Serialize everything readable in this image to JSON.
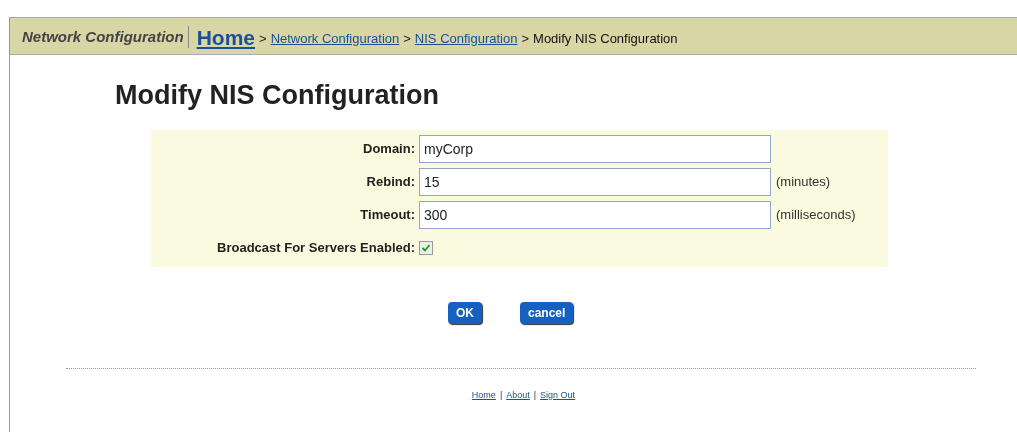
{
  "banner": {
    "section": "Network Configuration",
    "breadcrumb": [
      {
        "label": "Home",
        "kind": "home"
      },
      {
        "label": ">",
        "kind": "sep"
      },
      {
        "label": "Network Configuration",
        "kind": "link"
      },
      {
        "label": ">",
        "kind": "sep"
      },
      {
        "label": "NIS Configuration",
        "kind": "link"
      },
      {
        "label": ">",
        "kind": "sep"
      },
      {
        "label": "Modify NIS Configuration",
        "kind": "current"
      }
    ]
  },
  "title": "Modify NIS Configuration",
  "fields": [
    {
      "label": "Domain:",
      "kind": "text",
      "value": "myCorp"
    },
    {
      "label": "Rebind:",
      "kind": "text",
      "value": "15",
      "unit": "(minutes)"
    },
    {
      "label": "Timeout:",
      "kind": "text",
      "value": "300",
      "unit": "(milliseconds)"
    },
    {
      "label": "Broadcast For Servers Enabled:",
      "kind": "checkbox",
      "checked": true
    }
  ],
  "buttons": [
    "OK",
    "cancel"
  ],
  "footer": [
    {
      "label": "Home",
      "kind": "link"
    },
    {
      "label": "|",
      "kind": "sep"
    },
    {
      "label": "About",
      "kind": "link"
    },
    {
      "label": "|",
      "kind": "sep"
    },
    {
      "label": "Sign Out",
      "kind": "link"
    }
  ]
}
